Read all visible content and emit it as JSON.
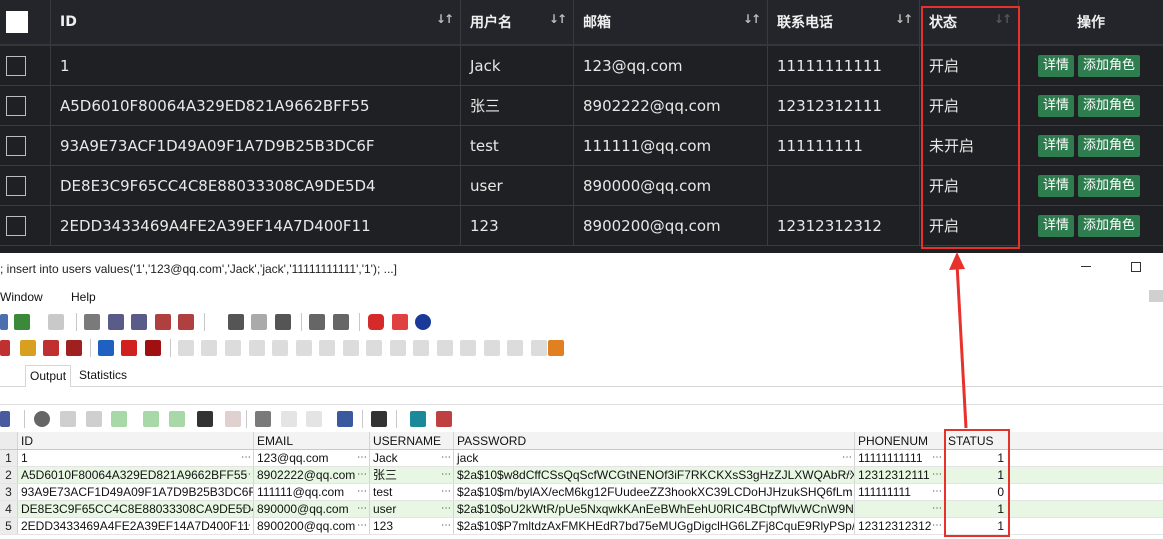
{
  "web_table": {
    "headers": {
      "id": "ID",
      "username": "用户名",
      "email": "邮箱",
      "phone": "联系电话",
      "status": "状态",
      "actions": "操作"
    },
    "sort_icon": "sort-arrows-icon",
    "rows": [
      {
        "id": "1",
        "username": "Jack",
        "email": "123@qq.com",
        "phone": "11111111111",
        "status": "开启"
      },
      {
        "id": "A5D6010F80064A329ED821A9662BFF55",
        "username": "张三",
        "email": "8902222@qq.com",
        "phone": "12312312111",
        "status": "开启"
      },
      {
        "id": "93A9E73ACF1D49A09F1A7D9B25B3DC6F",
        "username": "test",
        "email": "111111@qq.com",
        "phone": "111111111",
        "status": "未开启"
      },
      {
        "id": "DE8E3C9F65CC4C8E88033308CA9DE5D4",
        "username": "user",
        "email": "890000@qq.com",
        "phone": "",
        "status": "开启"
      },
      {
        "id": "2EDD3433469A4FE2A39EF14A7D400F11",
        "username": "123",
        "email": "8900200@qq.com",
        "phone": "12312312312",
        "status": "开启"
      }
    ],
    "detail_button": "详情",
    "add_role_button": "添加角色",
    "button_color": "#2e7d4f"
  },
  "ide": {
    "sql_text": "; insert into users values('1','123@qq.com','Jack','jack','11111111111','1'); ...]",
    "menu": {
      "window": "Window",
      "help": "Help"
    },
    "tabs": {
      "output": "Output",
      "statistics": "Statistics"
    },
    "grid": {
      "headers": {
        "id": "ID",
        "email": "EMAIL",
        "username": "USERNAME",
        "password": "PASSWORD",
        "phonenum": "PHONENUM",
        "status": "STATUS"
      },
      "rows": [
        {
          "n": "1",
          "id": "1",
          "email": "123@qq.com",
          "username": "Jack",
          "password": "jack",
          "phonenum": "11111111111",
          "status": "1"
        },
        {
          "n": "2",
          "id": "A5D6010F80064A329ED821A9662BFF55",
          "email": "8902222@qq.com",
          "username": "张三",
          "password": "$2a$10$w8dCffCSsQqScfWCGtNENOf3iF7RKCKXsS3gHzZJLXWQAbR/Xol",
          "phonenum": "12312312111",
          "status": "1"
        },
        {
          "n": "3",
          "id": "93A9E73ACF1D49A09F1A7D9B25B3DC6F",
          "email": "111111@qq.com",
          "username": "test",
          "password": "$2a$10$m/bylAX/ecM6kg12FUudeeZZ3hookXC39LCDoHJHzukSHQ6fLm",
          "phonenum": "111111111",
          "status": "0"
        },
        {
          "n": "4",
          "id": "DE8E3C9F65CC4C8E88033308CA9DE5D4",
          "email": "890000@qq.com",
          "username": "user",
          "password": "$2a$10$oU2kWtR/pUe5NxqwkKAnEeBWhEehU0RIC4BCtpfWlvWCnW9Nh",
          "phonenum": "",
          "status": "1"
        },
        {
          "n": "5",
          "id": "2EDD3433469A4FE2A39EF14A7D400F11",
          "email": "8900200@qq.com",
          "username": "123",
          "password": "$2a$10$P7mltdzAxFMKHEdR7bd75eMUGgDigclHG6LZFj8CquE9RlyPSp/r",
          "phonenum": "12312312312",
          "status": "1"
        }
      ]
    }
  },
  "annotation_color": "#e8312a"
}
